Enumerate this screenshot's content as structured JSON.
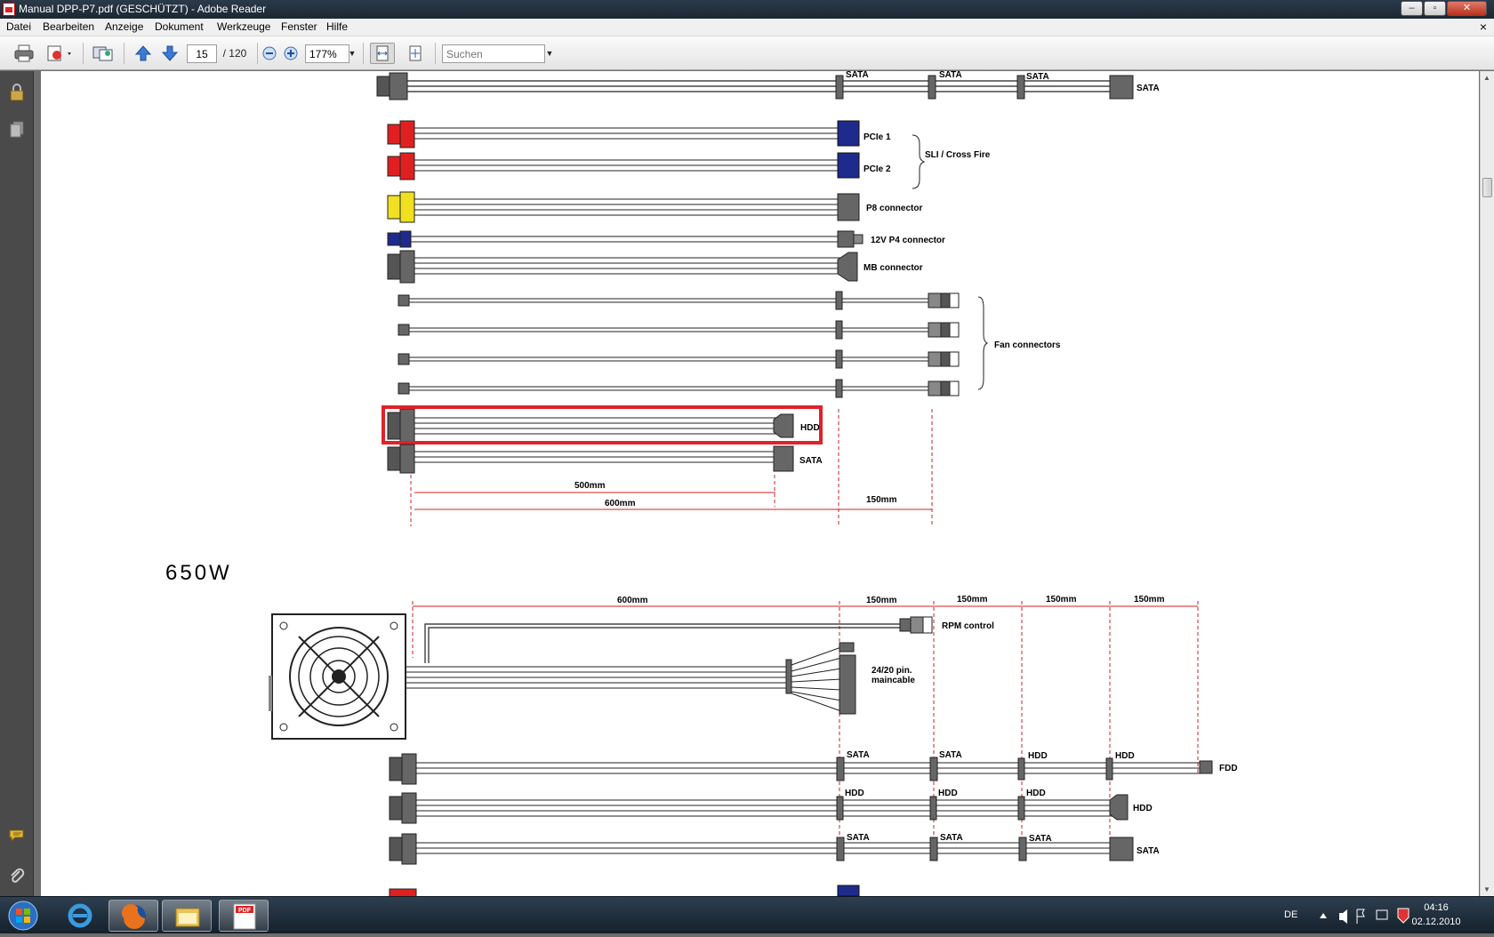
{
  "window": {
    "title": "Manual DPP-P7.pdf (GESCHÜTZT) - Adobe Reader"
  },
  "menubar": {
    "items": [
      "Datei",
      "Bearbeiten",
      "Anzeige",
      "Dokument",
      "Werkzeuge",
      "Fenster",
      "Hilfe"
    ],
    "close_glyph": "×"
  },
  "toolbar": {
    "page_current": "15",
    "page_total": "/ 120",
    "zoom": "177%",
    "search_placeholder": "Suchen"
  },
  "document": {
    "upper": {
      "labels": {
        "sata_top": [
          "SATA",
          "SATA",
          "SATA",
          "SATA"
        ],
        "pcie1": "PCIe 1",
        "pcie2": "PCIe 2",
        "sli": "SLI / Cross Fire",
        "p8": "P8 connector",
        "p4": "12V P4 connector",
        "mb": "MB connector",
        "fan": "Fan connectors",
        "hdd": "HDD",
        "sata": "SATA",
        "dim_500": "500mm",
        "dim_600": "600mm",
        "dim_150": "150mm"
      }
    },
    "lower": {
      "heading": "650W",
      "dims": [
        "600mm",
        "150mm",
        "150mm",
        "150mm",
        "150mm"
      ],
      "rpm": "RPM control",
      "maincable_1": "24/20 pin.",
      "maincable_2": "maincable",
      "row1": [
        "SATA",
        "SATA",
        "HDD",
        "HDD",
        "FDD"
      ],
      "row2": [
        "HDD",
        "HDD",
        "HDD",
        "HDD"
      ],
      "row3": [
        "SATA",
        "SATA",
        "SATA",
        "SATA"
      ]
    },
    "highlight_color": "#e0222a"
  },
  "tray": {
    "lang": "DE",
    "time": "04:16",
    "date": "02.12.2010"
  }
}
